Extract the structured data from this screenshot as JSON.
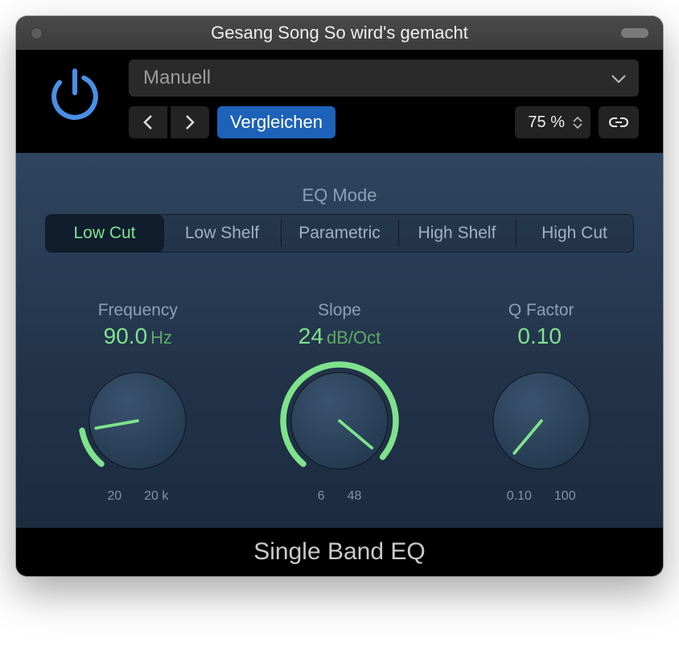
{
  "window": {
    "title": "Gesang Song So wird's gemacht"
  },
  "header": {
    "preset": "Manuell",
    "compare_label": "Vergleichen",
    "zoom": "75 %"
  },
  "eq": {
    "mode_label": "EQ Mode",
    "tabs": [
      "Low Cut",
      "Low Shelf",
      "Parametric",
      "High Shelf",
      "High Cut"
    ],
    "active_index": 0
  },
  "knobs": {
    "frequency": {
      "label": "Frequency",
      "value": "90.0",
      "unit": "Hz",
      "scale_min": "20",
      "scale_max": "20 k",
      "arc_start": 130,
      "arc_end": 170,
      "pointer": 170
    },
    "slope": {
      "label": "Slope",
      "value": "24",
      "unit": "dB/Oct",
      "scale_min": "6",
      "scale_max": "48",
      "arc_start": 130,
      "arc_end": 400,
      "pointer": 400
    },
    "qfactor": {
      "label": "Q Factor",
      "value": "0.10",
      "unit": "",
      "scale_min": "0.10",
      "scale_max": "100",
      "arc_start": 130,
      "arc_end": 130,
      "pointer": 130
    }
  },
  "footer": {
    "title": "Single Band EQ"
  },
  "colors": {
    "accent_green": "#7fe28c",
    "accent_blue": "#4a8fe6"
  }
}
